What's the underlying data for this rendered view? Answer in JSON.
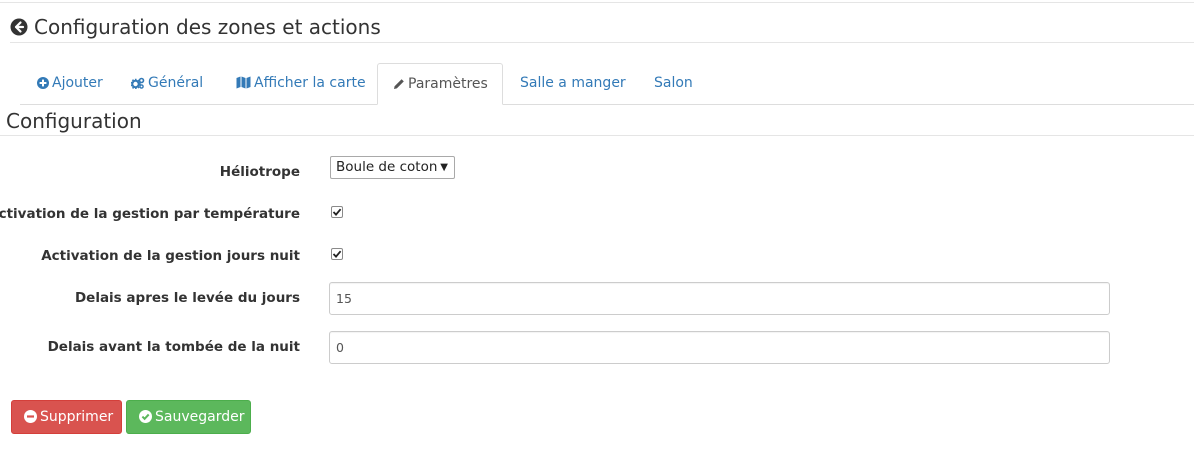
{
  "header": {
    "title": "Configuration des zones et actions",
    "back_icon": "arrow-circle-left-icon"
  },
  "tabs": [
    {
      "label": "Ajouter",
      "icon": "plus-circle-icon",
      "active": false
    },
    {
      "label": "Général",
      "icon": "cogs-icon",
      "active": false
    },
    {
      "label": "Afficher la carte",
      "icon": "map-icon",
      "active": false
    },
    {
      "label": "Paramètres",
      "icon": "pencil-icon",
      "active": true
    },
    {
      "label": "Salle a manger",
      "icon": "",
      "active": false
    },
    {
      "label": "Salon",
      "icon": "",
      "active": false
    }
  ],
  "section": {
    "title": "Configuration"
  },
  "form": {
    "heliotrope": {
      "label": "Héliotrope",
      "value": "Boule de coton"
    },
    "temp_management": {
      "label": "Activation de la gestion par température",
      "checked": true
    },
    "daynight_management": {
      "label": "Activation de la gestion jours nuit",
      "checked": true
    },
    "delay_after_sunrise": {
      "label": "Delais apres le levée du jours",
      "value": "15"
    },
    "delay_before_sunset": {
      "label": "Delais avant la tombée de la nuit",
      "value": "0"
    }
  },
  "buttons": {
    "delete": {
      "label": "Supprimer",
      "icon": "minus-circle-icon"
    },
    "save": {
      "label": "Sauvegarder",
      "icon": "check-circle-icon"
    }
  },
  "colors": {
    "link": "#337ab7",
    "danger": "#d9534f",
    "success": "#5cb85c"
  }
}
